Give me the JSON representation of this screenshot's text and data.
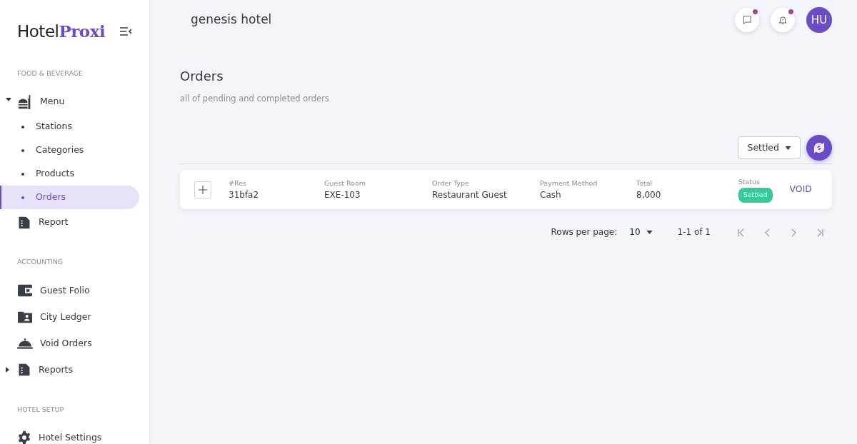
{
  "brand": {
    "part_1": "Hotel",
    "part_2": "Proxi"
  },
  "sidebar": {
    "sections": [
      {
        "heading": "FOOD & BEVERAGE",
        "items": [
          {
            "label": "Menu",
            "kind": "burger",
            "selected": false,
            "expanded": true,
            "children": [
              {
                "label": "Stations",
                "selected": false
              },
              {
                "label": "Categories",
                "selected": false
              },
              {
                "label": "Products",
                "selected": false
              },
              {
                "label": "Orders",
                "selected": true
              }
            ]
          },
          {
            "label": "Report",
            "kind": "document",
            "selected": false
          }
        ]
      },
      {
        "heading": "ACCOUNTING",
        "items": [
          {
            "label": "Guest Folio",
            "kind": "wallet",
            "selected": false
          },
          {
            "label": "City Ledger",
            "kind": "folder",
            "selected": false
          },
          {
            "label": "Void Orders",
            "kind": "cloche",
            "selected": false
          },
          {
            "label": "Reports",
            "kind": "document",
            "selected": false,
            "expanded": false
          }
        ]
      },
      {
        "heading": "HOTEL SETUP",
        "items": [
          {
            "label": "Hotel Settings",
            "kind": "gear",
            "selected": false
          }
        ]
      }
    ]
  },
  "header": {
    "hotel_name": "genesis hotel",
    "buttons": [
      {
        "kind": "chat",
        "unread": true
      },
      {
        "kind": "bell",
        "unread": true
      }
    ],
    "avatar": "HU"
  },
  "page": {
    "title": "Orders",
    "subtitle": "all of pending and completed orders"
  },
  "filter": {
    "value": "Settled"
  },
  "orders": [
    {
      "fields": [
        {
          "label": "#Res",
          "value": "31bfa2"
        },
        {
          "label": "Guest Room",
          "value": "EXE-103"
        },
        {
          "label": "Order Type",
          "value": "Restaurant Guest"
        },
        {
          "label": "Payment Method",
          "value": "Cash"
        },
        {
          "label": "Total",
          "value": "8,000"
        }
      ],
      "status_label": "Status",
      "status": "Settled",
      "action": "VOID"
    }
  ],
  "pagination": {
    "rows_per_page_label": "Rows per page:",
    "rows_per_page": "10",
    "range": "1-1 of 1"
  }
}
